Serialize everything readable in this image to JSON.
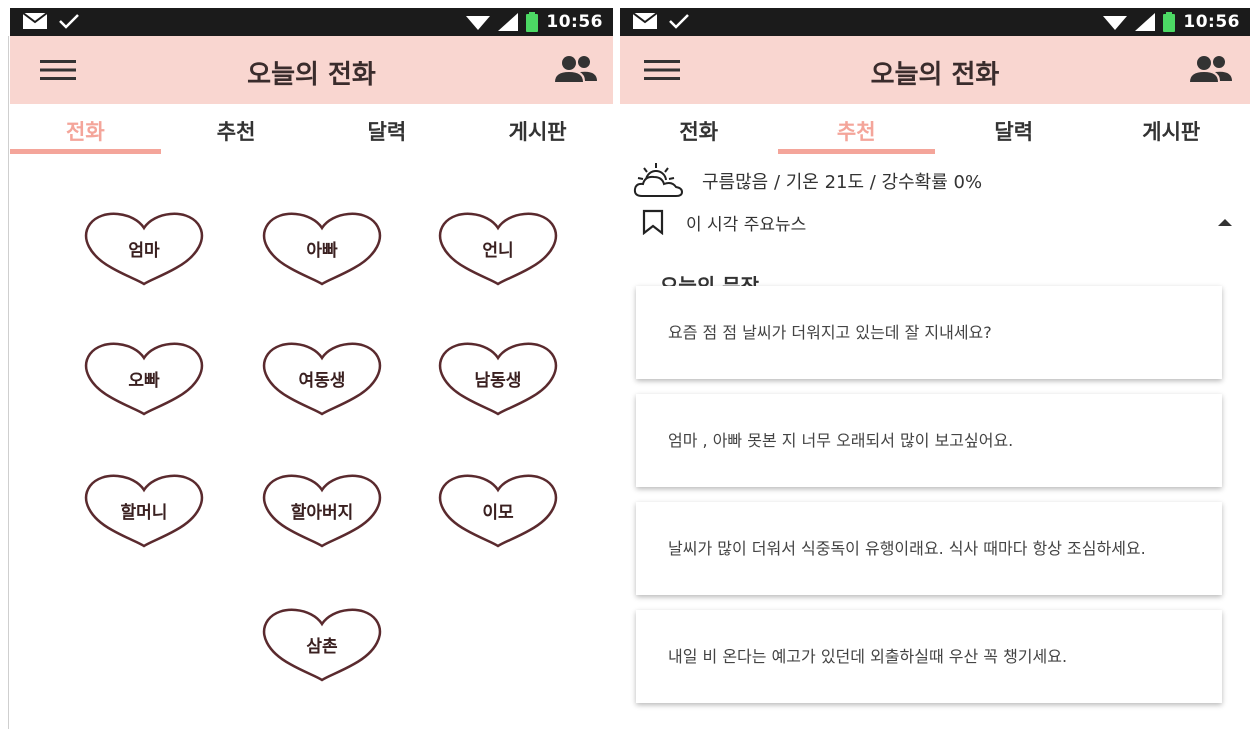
{
  "left_screen": {
    "status": {
      "time": "10:56"
    },
    "app_title": "오늘의 전화",
    "tabs": [
      {
        "label": "전화",
        "active": true
      },
      {
        "label": "추천",
        "active": false
      },
      {
        "label": "달력",
        "active": false
      },
      {
        "label": "게시판",
        "active": false
      }
    ],
    "contacts": [
      "엄마",
      "아빠",
      "언니",
      "오빠",
      "여동생",
      "남동생",
      "할머니",
      "할아버지",
      "이모",
      "삼촌"
    ]
  },
  "right_screen": {
    "status": {
      "time": "10:56"
    },
    "app_title": "오늘의 전화",
    "tabs": [
      {
        "label": "전화",
        "active": false
      },
      {
        "label": "추천",
        "active": true
      },
      {
        "label": "달력",
        "active": false
      },
      {
        "label": "게시판",
        "active": false
      }
    ],
    "weather": {
      "text": "구름많음 / 기온 21도 / 강수확률 0%",
      "icon": "partly-cloudy-icon"
    },
    "news": {
      "label": "이 시각 주요뉴스",
      "icon": "bookmark-icon",
      "expanded": true
    },
    "sentence_section_title": "오늘의 문장",
    "sentences": [
      "요즘 점 점 날씨가 더워지고 있는데 잘 지내세요?",
      "엄마 , 아빠 못본 지 너무 오래되서 많이 보고싶어요.",
      "날씨가 많이 더워서 식중독이 유행이래요. 식사 때마다 항상 조심하세요.",
      "내일 비 온다는 예고가 있던데 외출하실때 우산 꼭 챙기세요."
    ]
  },
  "colors": {
    "appbar": "#f9d6d0",
    "accent": "#f4a59a",
    "heart_stroke": "#5a2a2e",
    "statusbar": "#1b1b1b"
  }
}
